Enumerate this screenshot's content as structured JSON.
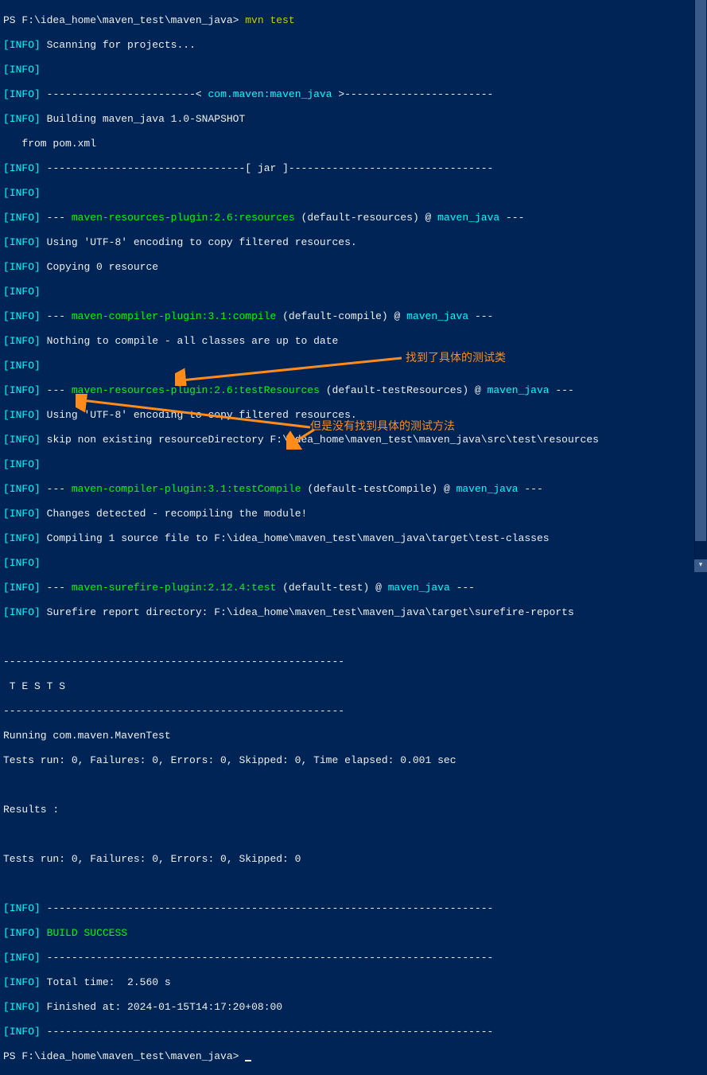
{
  "prompt1": "PS F:\\idea_home\\maven_test\\maven_java> ",
  "cmd1": "mvn test",
  "info": "INFO",
  "bracket_l": "[",
  "bracket_r": "]",
  "scan": " Scanning for projects...",
  "blank": "",
  "dashline_proj_pre": " ------------------------< ",
  "proj_id": "com.maven:maven_java",
  "dashline_proj_post": " >------------------------",
  "building": " Building maven_java 1.0-SNAPSHOT",
  "from_pom": "   from pom.xml",
  "dashline_jar_pre": " --------------------------------[ ",
  "jar": "jar",
  "dashline_jar_post": " ]---------------------------------",
  "dashes3": " --- ",
  "plugin_res": "maven-resources-plugin:2.6:resources",
  "plugin_res_post": " (default-resources) @ ",
  "mj": "maven_java",
  "dashes_end": " ---",
  "utf8": " Using 'UTF-8' encoding to copy filtered resources.",
  "copy0": " Copying 0 resource",
  "plugin_comp": "maven-compiler-plugin:3.1:compile",
  "plugin_comp_post": " (default-compile) @ ",
  "nothing": " Nothing to compile - all classes are up to date",
  "plugin_testres": "maven-resources-plugin:2.6:testResources",
  "plugin_testres_post": " (default-testResources) @ ",
  "skip_dir": " skip non existing resourceDirectory F:\\idea_home\\maven_test\\maven_java\\src\\test\\resources",
  "plugin_testcomp": "maven-compiler-plugin:3.1:testCompile",
  "plugin_testcomp_post": " (default-testCompile) @ ",
  "changes": " Changes detected - recompiling the module!",
  "compiling1": " Compiling 1 source file to F:\\idea_home\\maven_test\\maven_java\\target\\test-classes",
  "plugin_surefire": "maven-surefire-plugin:2.12.4:test",
  "plugin_surefire_post": " (default-test) @ ",
  "surefire_dir": " Surefire report directory: F:\\idea_home\\maven_test\\maven_java\\target\\surefire-reports",
  "tests_sep": "-------------------------------------------------------",
  "tests_hdr": " T E S T S",
  "running": "Running com.maven.MavenTest",
  "tests_run1": "Tests run: 0, Failures: 0, Errors: 0, Skipped: 0, Time elapsed: 0.001 sec",
  "results": "Results :",
  "tests_run2": "Tests run: 0, Failures: 0, Errors: 0, Skipped: 0",
  "long_dash": " ------------------------------------------------------------------------",
  "build_success": "BUILD SUCCESS",
  "total_time": " Total time:  2.560 s",
  "finished": " Finished at: 2024-01-15T14:17:20+08:00",
  "prompt2": "PS F:\\idea_home\\maven_test\\maven_java> ",
  "anno1": "找到了具体的测试类",
  "anno2": "但是没有找到具体的测试方法",
  "scroll_down_glyph": "▾"
}
